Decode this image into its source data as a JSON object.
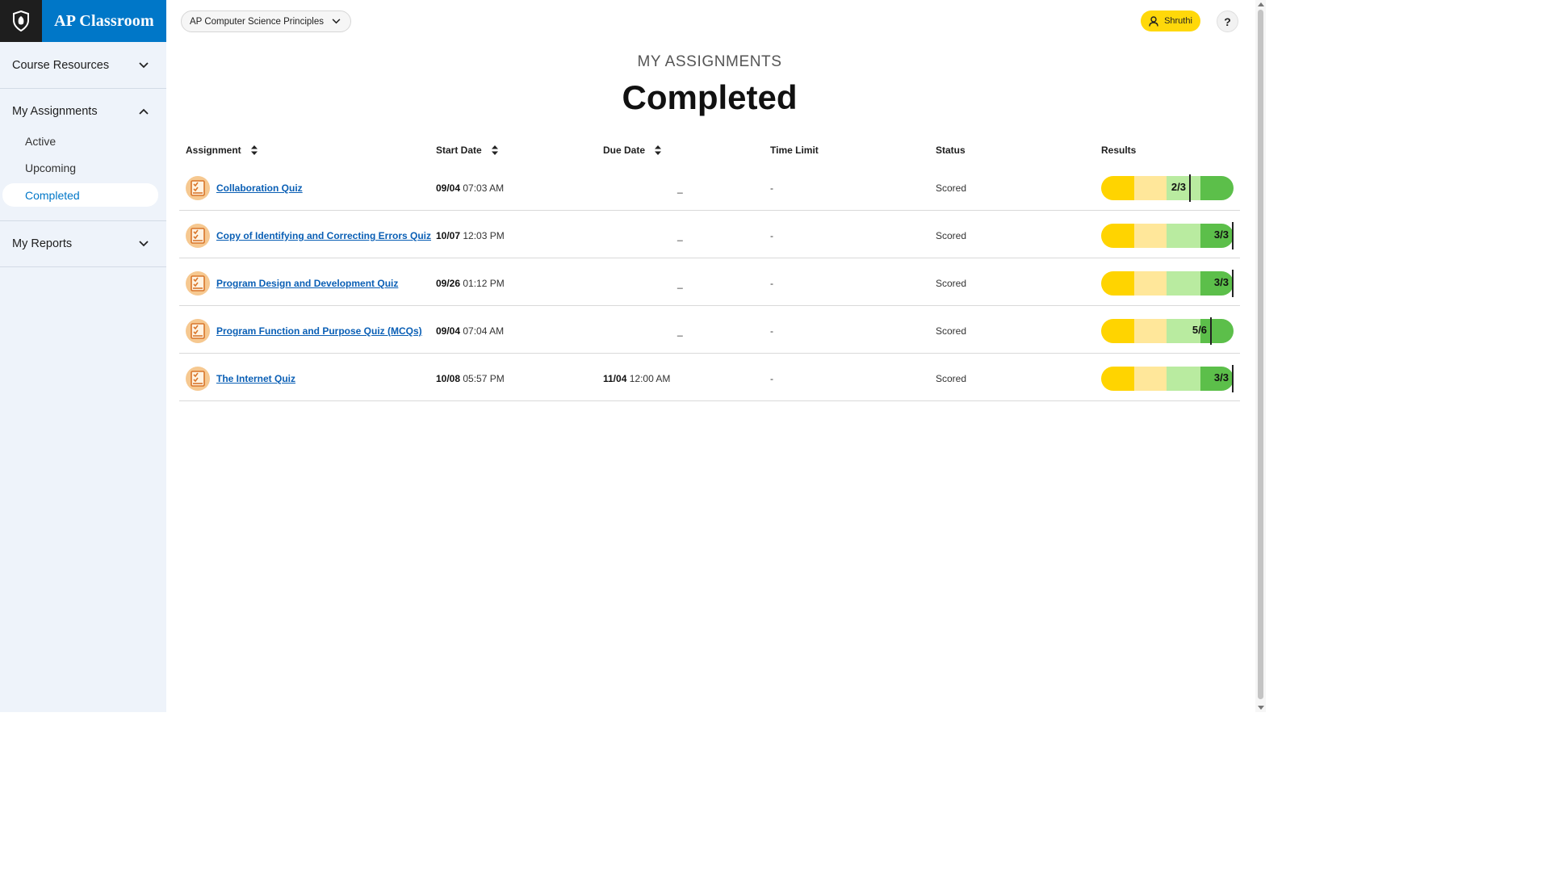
{
  "brand": {
    "name": "AP Classroom",
    "logo_icon": "shield-acorn-icon"
  },
  "sidebar": {
    "sections": [
      {
        "label": "Course Resources",
        "expanded": false
      },
      {
        "label": "My Assignments",
        "expanded": true,
        "items": [
          {
            "label": "Active"
          },
          {
            "label": "Upcoming"
          },
          {
            "label": "Completed",
            "active": true
          }
        ]
      },
      {
        "label": "My Reports",
        "expanded": false
      }
    ]
  },
  "header": {
    "course": "AP Computer Science Principles",
    "user": "Shruthi",
    "help": "?"
  },
  "page": {
    "kicker": "MY ASSIGNMENTS",
    "title": "Completed"
  },
  "table": {
    "columns": [
      "Assignment",
      "Start Date",
      "Due Date",
      "Time Limit",
      "Status",
      "Results"
    ],
    "rows": [
      {
        "name": "Collaboration Quiz",
        "start_date": "09/04",
        "start_time": "07:03 AM",
        "due_date": "",
        "due_time": "",
        "due_placeholder": "_",
        "time_limit": "-",
        "status": "Scored",
        "score": "2/3",
        "fraction": 0.667
      },
      {
        "name": "Copy of Identifying and Correcting Errors Quiz",
        "start_date": "10/07",
        "start_time": "12:03 PM",
        "due_date": "",
        "due_time": "",
        "due_placeholder": "_",
        "time_limit": "-",
        "status": "Scored",
        "score": "3/3",
        "fraction": 1.0
      },
      {
        "name": "Program Design and Development Quiz",
        "start_date": "09/26",
        "start_time": "01:12 PM",
        "due_date": "",
        "due_time": "",
        "due_placeholder": "_",
        "time_limit": "-",
        "status": "Scored",
        "score": "3/3",
        "fraction": 1.0
      },
      {
        "name": "Program Function and Purpose Quiz (MCQs)",
        "start_date": "09/04",
        "start_time": "07:04 AM",
        "due_date": "",
        "due_time": "",
        "due_placeholder": "_",
        "time_limit": "-",
        "status": "Scored",
        "score": "5/6",
        "fraction": 0.833
      },
      {
        "name": "The Internet Quiz",
        "start_date": "10/08",
        "start_time": "05:57 PM",
        "due_date": "11/04",
        "due_time": "12:00 AM",
        "due_placeholder": "",
        "time_limit": "-",
        "status": "Scored",
        "score": "3/3",
        "fraction": 1.0
      }
    ]
  },
  "colors": {
    "brand_blue": "#0077c8",
    "link_blue": "#0a5fb5",
    "user_yellow": "#ffd80a",
    "result_segments": [
      "#ffd400",
      "#ffe79a",
      "#b9eba0",
      "#5cbf4a"
    ]
  }
}
